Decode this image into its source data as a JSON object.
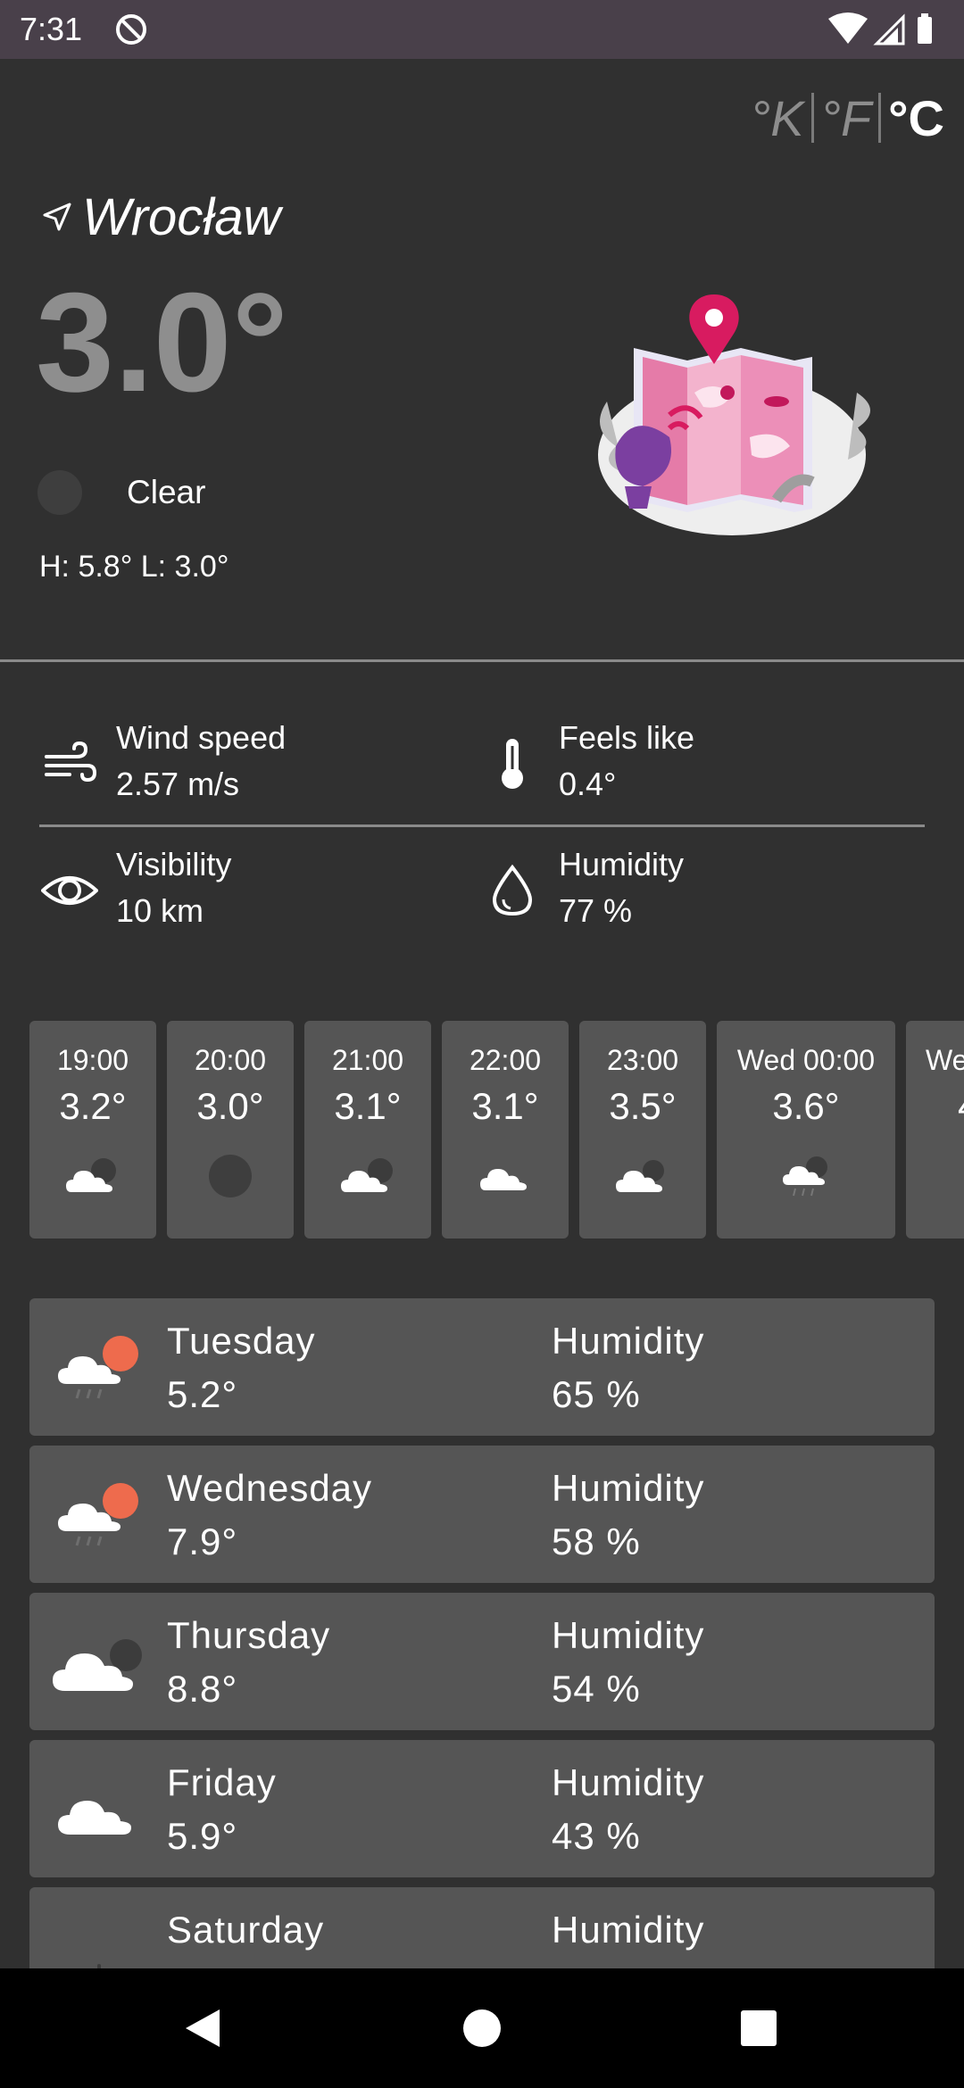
{
  "status_bar": {
    "time": "7:31"
  },
  "units": {
    "kelvin": "°K",
    "fahrenheit": "°F",
    "celsius": "°C",
    "selected": "°C"
  },
  "location": {
    "city": "Wrocław"
  },
  "current": {
    "temperature": "3.0°",
    "condition": "Clear",
    "high_low": "H: 5.8° L: 3.0°"
  },
  "details": {
    "wind": {
      "label": "Wind speed",
      "value": "2.57 m/s",
      "icon": "wind-icon"
    },
    "feels": {
      "label": "Feels like",
      "value": "0.4°",
      "icon": "thermometer-icon"
    },
    "visibility": {
      "label": "Visibility",
      "value": "10 km",
      "icon": "eye-icon"
    },
    "humidity": {
      "label": "Humidity",
      "value": "77 %",
      "icon": "droplet-icon"
    }
  },
  "hourly": [
    {
      "time": "19:00",
      "temp": "3.2°",
      "icon": "cloud-icon"
    },
    {
      "time": "20:00",
      "temp": "3.0°",
      "icon": "clear-night-icon"
    },
    {
      "time": "21:00",
      "temp": "3.1°",
      "icon": "cloud-icon"
    },
    {
      "time": "22:00",
      "temp": "3.1°",
      "icon": "cloud-icon"
    },
    {
      "time": "23:00",
      "temp": "3.5°",
      "icon": "cloud-icon"
    },
    {
      "time": "Wed 00:00",
      "temp": "3.6°",
      "icon": "rain-cloud-icon"
    },
    {
      "time": "We",
      "temp": "4",
      "icon": "cloud-icon"
    }
  ],
  "daily": [
    {
      "day": "Tuesday",
      "temp": "5.2°",
      "humidity_label": "Humidity",
      "humidity": "65 %",
      "icon": "sun-rain-cloud-icon"
    },
    {
      "day": "Wednesday",
      "temp": "7.9°",
      "humidity_label": "Humidity",
      "humidity": "58 %",
      "icon": "sun-rain-cloud-icon"
    },
    {
      "day": "Thursday",
      "temp": "8.8°",
      "humidity_label": "Humidity",
      "humidity": "54 %",
      "icon": "cloud-icon"
    },
    {
      "day": "Friday",
      "temp": "5.9°",
      "humidity_label": "Humidity",
      "humidity": "43 %",
      "icon": "cloud-icon"
    },
    {
      "day": "Saturday",
      "temp": "",
      "humidity_label": "Humidity",
      "humidity": "",
      "icon": "snowflake-icon"
    }
  ],
  "colors": {
    "background": "#303030",
    "card": "#555555",
    "status_bar": "#49404a",
    "muted_text": "#8e8e8e",
    "accent_sun": "#ee6b4d",
    "illustration_pink": "#d81b60"
  }
}
